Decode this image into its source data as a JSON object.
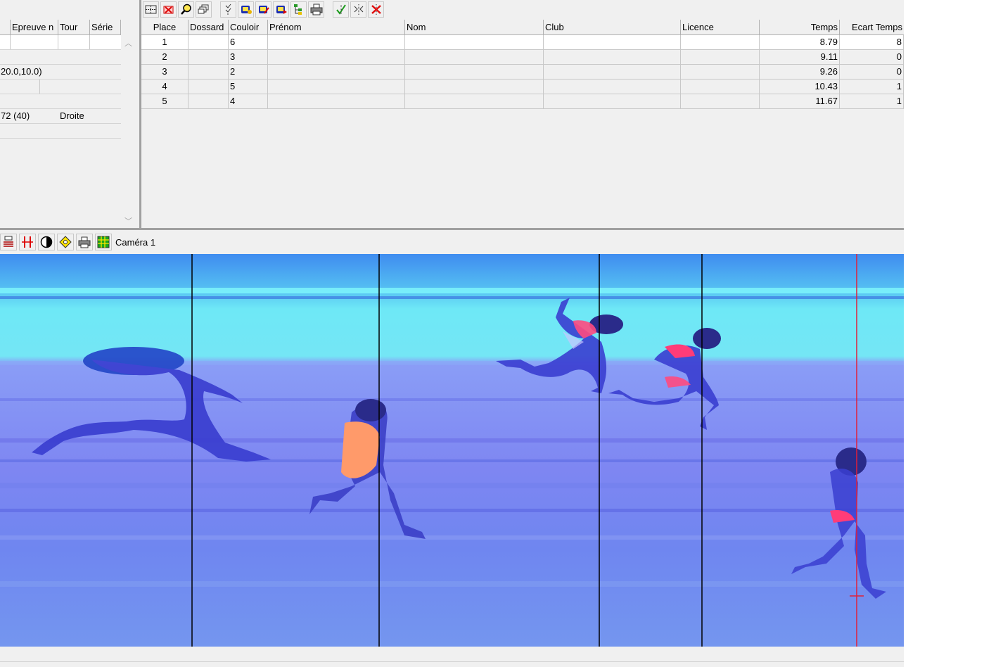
{
  "toolbar": {
    "icons": [
      "grid-icon",
      "delete-icon",
      "zoom-icon",
      "windows-icon",
      "checklist-icon",
      "record-icon",
      "record-edit-icon",
      "record-play-icon",
      "tree-icon",
      "print-icon",
      "check-icon",
      "split-icon",
      "reject-icon"
    ]
  },
  "left_panel": {
    "headers": [
      "Epreuve n",
      "Tour",
      "Série"
    ],
    "rows": [
      {
        "c1": "",
        "c2": "",
        "c3": ""
      },
      {
        "c1": "",
        "c2": "",
        "c3": ""
      },
      {
        "c1": "20.0,10.0)",
        "c2": "",
        "c3": ""
      },
      {
        "c1": "",
        "c2": "",
        "c3": ""
      },
      {
        "c1": "",
        "c2": "",
        "c3": ""
      },
      {
        "c1": "72  (40)",
        "c2": "Droite",
        "c3": ""
      },
      {
        "c1": "",
        "c2": "",
        "c3": ""
      }
    ]
  },
  "results": {
    "headers": {
      "place": "Place",
      "dossard": "Dossard",
      "couloir": "Couloir",
      "prenom": "Prénom",
      "nom": "Nom",
      "club": "Club",
      "licence": "Licence",
      "temps": "Temps",
      "ecart": "Ecart Temps"
    },
    "rows": [
      {
        "place": "1",
        "dossard": "",
        "couloir": "6",
        "prenom": "",
        "nom": "",
        "club": "",
        "licence": "",
        "temps": "8.79",
        "ecart": "8"
      },
      {
        "place": "2",
        "dossard": "",
        "couloir": "3",
        "prenom": "",
        "nom": "",
        "club": "",
        "licence": "",
        "temps": "9.11",
        "ecart": "0"
      },
      {
        "place": "3",
        "dossard": "",
        "couloir": "2",
        "prenom": "",
        "nom": "",
        "club": "",
        "licence": "",
        "temps": "9.26",
        "ecart": "0"
      },
      {
        "place": "4",
        "dossard": "",
        "couloir": "5",
        "prenom": "",
        "nom": "",
        "club": "",
        "licence": "",
        "temps": "10.43",
        "ecart": "1"
      },
      {
        "place": "5",
        "dossard": "",
        "couloir": "4",
        "prenom": "",
        "nom": "",
        "club": "",
        "licence": "",
        "temps": "11.67",
        "ecart": "1"
      }
    ]
  },
  "camera": {
    "label": "Caméra 1",
    "icons": [
      "lanes-icon",
      "time-cursor-icon",
      "contrast-icon",
      "brightness-icon",
      "print-icon",
      "table-icon"
    ]
  },
  "colors": {
    "track_blue": "#6e7af0",
    "sky_cyan": "#6fe8f6",
    "finish_line": "#e0203a",
    "athlete_orange": "#ff9a6a"
  }
}
